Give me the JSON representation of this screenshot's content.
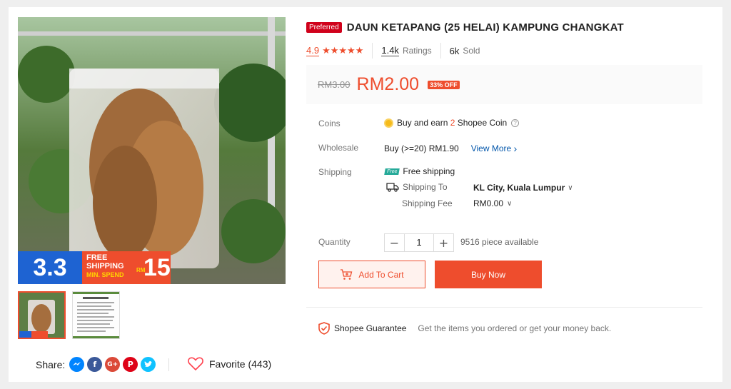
{
  "product": {
    "preferred_badge": "Preferred",
    "title": "DAUN KETAPANG (25 HELAI) KAMPUNG CHANGKAT",
    "rating": "4.9",
    "stars": "★★★★★",
    "ratings_count": "1.4k",
    "ratings_label": "Ratings",
    "sold_count": "6k",
    "sold_label": "Sold"
  },
  "price": {
    "original": "RM3.00",
    "current": "RM2.00",
    "discount": "33% OFF"
  },
  "coins": {
    "label": "Coins",
    "text_before": "Buy and earn",
    "amount": "2",
    "text_after": "Shopee Coin",
    "help": "?"
  },
  "wholesale": {
    "label": "Wholesale",
    "text": "Buy (>=20) RM1.90",
    "link": "View More",
    "chevron": "›"
  },
  "shipping": {
    "label": "Shipping",
    "free_tag": "Free",
    "free_text": "Free shipping",
    "to_label": "Shipping To",
    "to_value": "KL City, Kuala Lumpur",
    "fee_label": "Shipping Fee",
    "fee_value": "RM0.00",
    "chevron": "∨"
  },
  "quantity": {
    "label": "Quantity",
    "minus": "−",
    "value": "1",
    "plus": "+",
    "available": "9516 piece available"
  },
  "actions": {
    "add_to_cart": "Add To Cart",
    "buy_now": "Buy Now"
  },
  "guarantee": {
    "title": "Shopee Guarantee",
    "subtitle": "Get the items you ordered or get your money back."
  },
  "banner": {
    "big": "3.3",
    "line1": "FREE",
    "line2": "SHIPPING",
    "line3": "MIN. SPEND",
    "currency": "RM",
    "amount": "15"
  },
  "share": {
    "label": "Share:",
    "networks": [
      "messenger-icon",
      "facebook-icon",
      "google-plus-icon",
      "pinterest-icon",
      "twitter-icon"
    ]
  },
  "favorite": {
    "label": "Favorite (443)"
  },
  "colors": {
    "accent": "#ee4d2d",
    "preferred": "#d0011b",
    "link": "#0055aa"
  }
}
